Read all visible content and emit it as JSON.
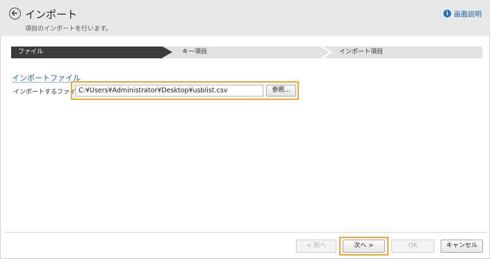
{
  "header": {
    "title": "インポート",
    "subtitle": "項目のインポートを行います。",
    "help_label": "画面説明"
  },
  "steps": [
    {
      "label": "ファイル",
      "active": true
    },
    {
      "label": "キー項目",
      "active": false
    },
    {
      "label": "インポート項目",
      "active": false
    }
  ],
  "section": {
    "title": "インポートファイル",
    "file_label": "インポートするファイル",
    "required_mark": "*:",
    "file_value": "C:¥Users¥Administrator¥Desktop¥usblist.csv",
    "browse_label": "参照..."
  },
  "footer": {
    "prev_label": "< 前へ",
    "next_label": "次へ >",
    "ok_label": "OK",
    "cancel_label": "キャンセル"
  },
  "colors": {
    "highlight": "#f0a830",
    "accent": "#1f5fa6",
    "active_step": "#3c3c3c"
  }
}
